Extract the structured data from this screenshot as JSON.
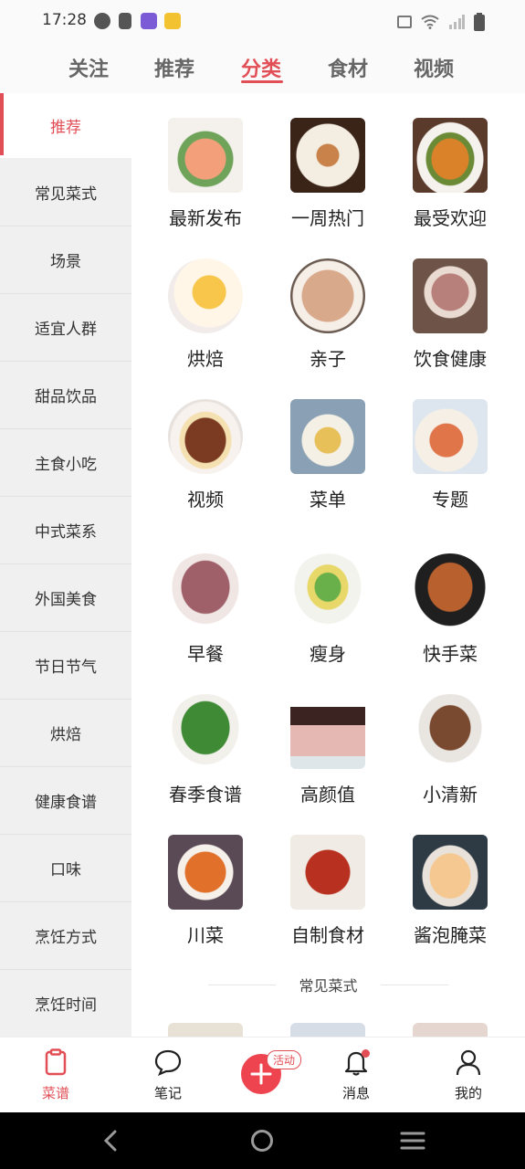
{
  "status_bar": {
    "time": "17:28"
  },
  "tabs": [
    {
      "label": "关注",
      "active": false
    },
    {
      "label": "推荐",
      "active": false
    },
    {
      "label": "分类",
      "active": true
    },
    {
      "label": "食材",
      "active": false
    },
    {
      "label": "视频",
      "active": false
    }
  ],
  "sidebar": {
    "items": [
      {
        "label": "推荐",
        "active": true
      },
      {
        "label": "常见菜式"
      },
      {
        "label": "场景"
      },
      {
        "label": "适宜人群"
      },
      {
        "label": "甜品饮品"
      },
      {
        "label": "主食小吃"
      },
      {
        "label": "中式菜系"
      },
      {
        "label": "外国美食"
      },
      {
        "label": "节日节气"
      },
      {
        "label": "烘焙"
      },
      {
        "label": "健康食谱"
      },
      {
        "label": "口味"
      },
      {
        "label": "烹饪方式"
      },
      {
        "label": "烹饪时间"
      }
    ]
  },
  "categories": [
    {
      "label": "最新发布",
      "icon": "shrimp-dish-photo"
    },
    {
      "label": "一周热门",
      "icon": "noodle-plate-photo"
    },
    {
      "label": "最受欢迎",
      "icon": "braised-dish-photo"
    },
    {
      "label": "烘焙",
      "icon": "cake-slice-photo"
    },
    {
      "label": "亲子",
      "icon": "bear-buns-photo"
    },
    {
      "label": "饮食健康",
      "icon": "congee-bowl-photo"
    },
    {
      "label": "视频",
      "icon": "ribs-plate-photo"
    },
    {
      "label": "菜单",
      "icon": "soup-bowl-photo"
    },
    {
      "label": "专题",
      "icon": "cake-platter-photo"
    },
    {
      "label": "早餐",
      "icon": "porridge-photo"
    },
    {
      "label": "瘦身",
      "icon": "veg-salad-photo"
    },
    {
      "label": "快手菜",
      "icon": "tofu-dish-photo"
    },
    {
      "label": "春季食谱",
      "icon": "greens-photo"
    },
    {
      "label": "高颜值",
      "icon": "drip-cake-photo"
    },
    {
      "label": "小清新",
      "icon": "stew-plate-photo"
    },
    {
      "label": "川菜",
      "icon": "spicy-soup-photo"
    },
    {
      "label": "自制食材",
      "icon": "jam-jar-photo"
    },
    {
      "label": "酱泡腌菜",
      "icon": "pickled-radish-photo"
    }
  ],
  "section": {
    "title": "常见菜式"
  },
  "bottom_nav": {
    "items": [
      {
        "label": "菜谱",
        "icon": "clipboard-icon",
        "active": true
      },
      {
        "label": "笔记",
        "icon": "chat-bubble-icon"
      },
      {
        "label": "消息",
        "icon": "bell-icon"
      },
      {
        "label": "我的",
        "icon": "person-icon"
      }
    ],
    "fab_badge": "活动"
  },
  "colors": {
    "accent": "#e24e55",
    "sidebar_bg": "#f0f0f0"
  }
}
